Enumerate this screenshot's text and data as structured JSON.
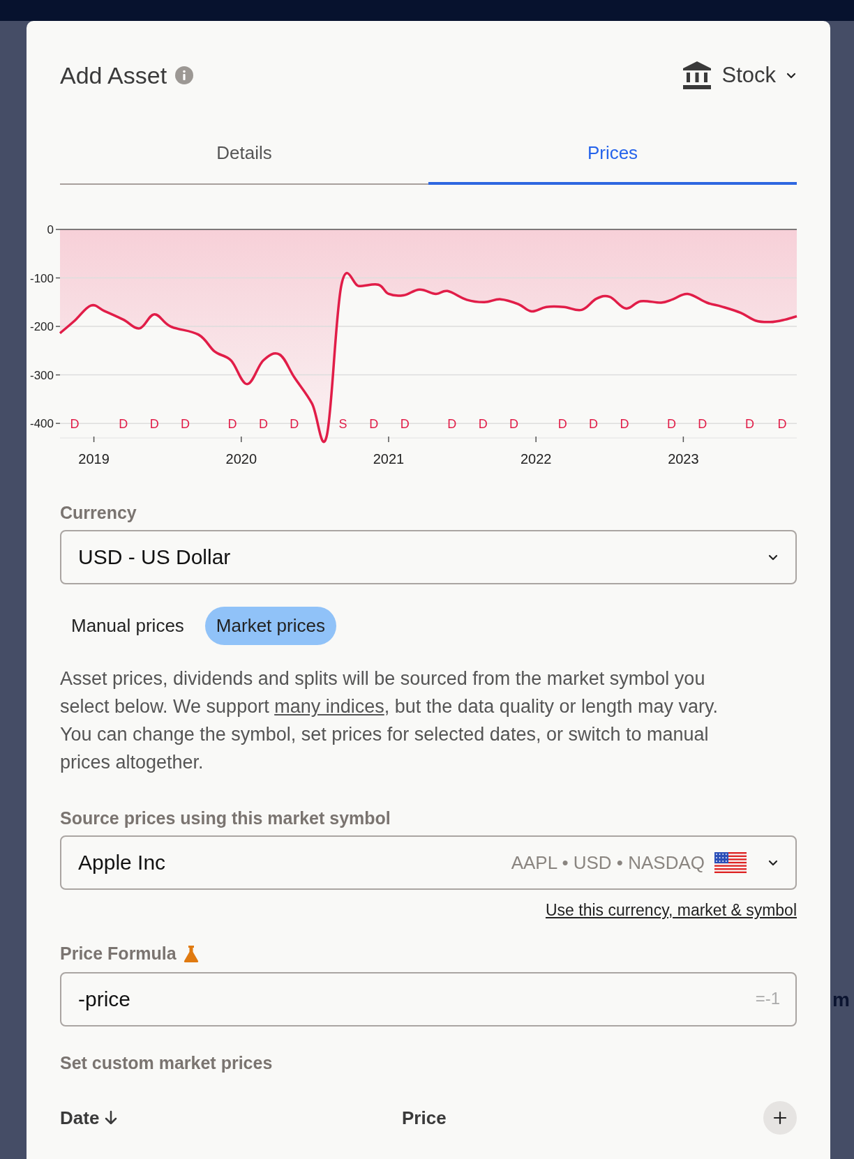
{
  "backdrop_text": "m",
  "dialog": {
    "title": "Add Asset",
    "asset_type": "Stock"
  },
  "tabs": [
    {
      "label": "Details",
      "selected": false
    },
    {
      "label": "Prices",
      "selected": true
    }
  ],
  "chart_data": {
    "type": "area",
    "grid": true,
    "xlim": [
      2018.77,
      2023.77
    ],
    "ylim": [
      -430,
      0
    ],
    "xticks": [
      2019,
      2020,
      2021,
      2022,
      2023
    ],
    "yticks": [
      0,
      -100,
      -200,
      -300,
      -400
    ],
    "x": [
      2018.77,
      2018.87,
      2018.98,
      2019.07,
      2019.2,
      2019.31,
      2019.41,
      2019.52,
      2019.71,
      2019.82,
      2019.93,
      2020.04,
      2020.15,
      2020.26,
      2020.36,
      2020.48,
      2020.58,
      2020.68,
      2020.8,
      2020.93,
      2021.0,
      2021.1,
      2021.21,
      2021.32,
      2021.4,
      2021.53,
      2021.65,
      2021.76,
      2021.88,
      2021.97,
      2022.07,
      2022.19,
      2022.31,
      2022.41,
      2022.5,
      2022.61,
      2022.71,
      2022.85,
      2022.93,
      2023.03,
      2023.16,
      2023.26,
      2023.39,
      2023.49,
      2023.59,
      2023.69,
      2023.77
    ],
    "series": [
      {
        "color": "#e11d48",
        "values": [
          -214,
          -188,
          -157,
          -168,
          -186,
          -204,
          -175,
          -200,
          -217,
          -252,
          -270,
          -319,
          -270,
          -258,
          -305,
          -359,
          -426,
          -114,
          -117,
          -114,
          -133,
          -136,
          -124,
          -133,
          -127,
          -145,
          -150,
          -144,
          -154,
          -169,
          -160,
          -160,
          -166,
          -143,
          -139,
          -163,
          -148,
          -151,
          -144,
          -133,
          -151,
          -159,
          -172,
          -188,
          -191,
          -186,
          -179
        ]
      }
    ],
    "annotations": [
      "D",
      "D",
      "D",
      "D",
      "D",
      "D",
      "D",
      "S",
      "D",
      "D",
      "D",
      "D",
      "D",
      "D",
      "D",
      "D",
      "D",
      "D",
      "D",
      "D"
    ]
  },
  "currency": {
    "label": "Currency",
    "value": "USD - US Dollar"
  },
  "price_modes": [
    {
      "label": "Manual prices",
      "selected": false
    },
    {
      "label": "Market prices",
      "selected": true
    }
  ],
  "description": {
    "before": "Asset prices, dividends and splits will be sourced from the market symbol you select below. We support ",
    "link": "many indices",
    "after": ", but the data quality or length may vary. You can change the symbol, set prices for selected dates, or switch to manual prices altogether."
  },
  "symbol": {
    "label": "Source prices using this market symbol",
    "name": "Apple Inc",
    "details": "AAPL • USD • NASDAQ"
  },
  "use_link": "Use this currency, market & symbol",
  "formula": {
    "label": "Price Formula",
    "value": "-price",
    "result": "=-1"
  },
  "custom_prices": {
    "title": "Set custom market prices",
    "columns": [
      "Date",
      "Price"
    ]
  }
}
